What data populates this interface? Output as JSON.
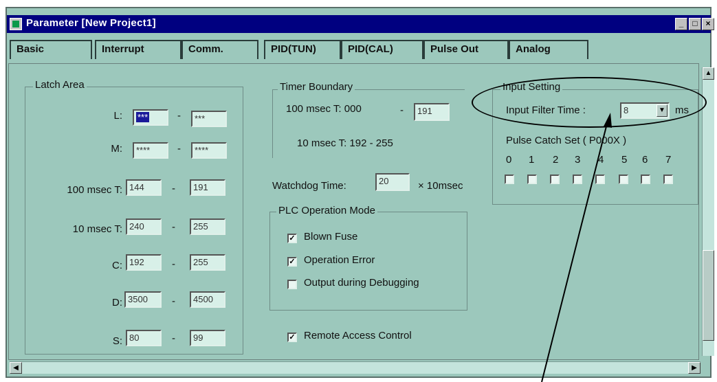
{
  "window": {
    "title": "Parameter [New Project1]",
    "controls": {
      "minimize": "_",
      "maximize": "□",
      "close": "×"
    }
  },
  "tabs": [
    "Basic",
    "Interrupt",
    "Comm.",
    "PID(TUN)",
    "PID(CAL)",
    "Pulse Out",
    "Analog"
  ],
  "latch_area": {
    "title": "Latch Area",
    "rows": [
      {
        "label": "L:",
        "from": "***",
        "to": "***"
      },
      {
        "label": "M:",
        "from": "****",
        "to": "****"
      },
      {
        "label": "100 msec T:",
        "from": "144",
        "to": "191"
      },
      {
        "label": "10 msec T:",
        "from": "240",
        "to": "255"
      },
      {
        "label": "C:",
        "from": "192",
        "to": "255"
      },
      {
        "label": "D:",
        "from": "3500",
        "to": "4500"
      },
      {
        "label": "S:",
        "from": "80",
        "to": "99"
      }
    ],
    "separator": "-"
  },
  "timer_boundary": {
    "title": "Timer Boundary",
    "row1_label": "100 msec T: 000",
    "row1_dash": "-",
    "row1_value": "191",
    "row2_text": "10 msec T: 192  -  255"
  },
  "watchdog": {
    "label": "Watchdog Time:",
    "value": "20",
    "unit": "× 10msec"
  },
  "plc_mode": {
    "title": "PLC Operation Mode",
    "options": [
      {
        "label": "Blown Fuse",
        "checked": true
      },
      {
        "label": "Operation Error",
        "checked": true
      },
      {
        "label": "Output during Debugging",
        "checked": false
      }
    ]
  },
  "remote_access": {
    "label": "Remote Access Control",
    "checked": true
  },
  "input_setting": {
    "title": "Input Setting",
    "filter_label": "Input Filter Time :",
    "filter_value": "8",
    "filter_unit": "ms",
    "pulse_catch_label": "Pulse Catch Set ( P000X )",
    "bits": [
      "0",
      "1",
      "2",
      "3",
      "4",
      "5",
      "6",
      "7"
    ]
  },
  "colors": {
    "title_bar": "#000080",
    "panel": "#9cc8bc",
    "field": "#d8f0e8"
  }
}
